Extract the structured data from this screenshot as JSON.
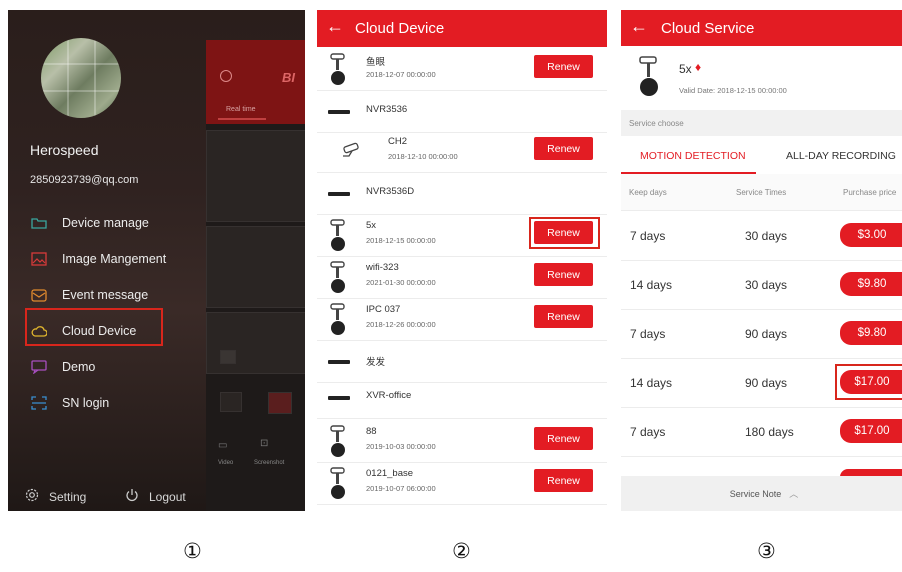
{
  "panel1": {
    "user_name": "Herospeed",
    "user_email": "2850923739@qq.com",
    "menu": [
      {
        "label": "Device manage",
        "icon": "folder-icon"
      },
      {
        "label": "Image Mangement",
        "icon": "image-icon"
      },
      {
        "label": "Event message",
        "icon": "envelope-icon"
      },
      {
        "label": "Cloud Device",
        "icon": "cloud-icon",
        "highlighted": true
      },
      {
        "label": "Demo",
        "icon": "chat-icon"
      },
      {
        "label": "SN login",
        "icon": "scan-icon"
      }
    ],
    "setting_label": "Setting",
    "logout_label": "Logout",
    "background_app": {
      "tab_label": "Real time",
      "video_label": "Video",
      "screenshot_label": "Screenshot",
      "brand_fragment": "BI"
    }
  },
  "panel2": {
    "title": "Cloud Device",
    "devices": [
      {
        "name": "鱼眼",
        "date": "2018-12-07 00:00:00",
        "kind": "camera",
        "action": "Renew"
      },
      {
        "name": "NVR3536",
        "date": "",
        "kind": "nvr",
        "action": ""
      },
      {
        "name": "CH2",
        "date": "2018-12-10 00:00:00",
        "kind": "channel",
        "action": "Renew"
      },
      {
        "name": "NVR3536D",
        "date": "",
        "kind": "nvr",
        "action": ""
      },
      {
        "name": "5x",
        "date": "2018-12-15 00:00:00",
        "kind": "camera",
        "action": "Renew",
        "highlighted": true
      },
      {
        "name": "wifi-323",
        "date": "2021-01-30 00:00:00",
        "kind": "camera",
        "action": "Renew"
      },
      {
        "name": "IPC 037",
        "date": "2018-12-26 00:00:00",
        "kind": "camera",
        "action": "Renew"
      },
      {
        "name": "发发",
        "date": "",
        "kind": "nvr",
        "action": ""
      },
      {
        "name": "XVR-office",
        "date": "",
        "kind": "nvr",
        "action": ""
      },
      {
        "name": "88",
        "date": "2019-10-03 00:00:00",
        "kind": "camera",
        "action": "Renew"
      },
      {
        "name": "0121_base",
        "date": "2019-10-07 06:00:00",
        "kind": "camera",
        "action": "Renew"
      }
    ]
  },
  "panel3": {
    "title": "Cloud Service",
    "device_name": "5x",
    "valid_date": "Valid Date: 2018-12-15 00:00:00",
    "service_choose": "Service choose",
    "tabs": [
      "MOTION DETECTION",
      "ALL-DAY RECORDING"
    ],
    "active_tab": 0,
    "columns": [
      "Keep days",
      "Service Times",
      "Purchase price"
    ],
    "plans": [
      {
        "keep": "7 days",
        "times": "30 days",
        "price": "$3.00"
      },
      {
        "keep": "14 days",
        "times": "30 days",
        "price": "$9.80"
      },
      {
        "keep": "7 days",
        "times": "90 days",
        "price": "$9.80"
      },
      {
        "keep": "14 days",
        "times": "90 days",
        "price": "$17.00",
        "highlighted": true
      },
      {
        "keep": "7 days",
        "times": "180 days",
        "price": "$17.00"
      }
    ],
    "service_note": "Service Note"
  },
  "captions": [
    "①",
    "②",
    "③"
  ],
  "colors": {
    "accent": "#e31c23",
    "highlight_border": "#d8261c"
  }
}
